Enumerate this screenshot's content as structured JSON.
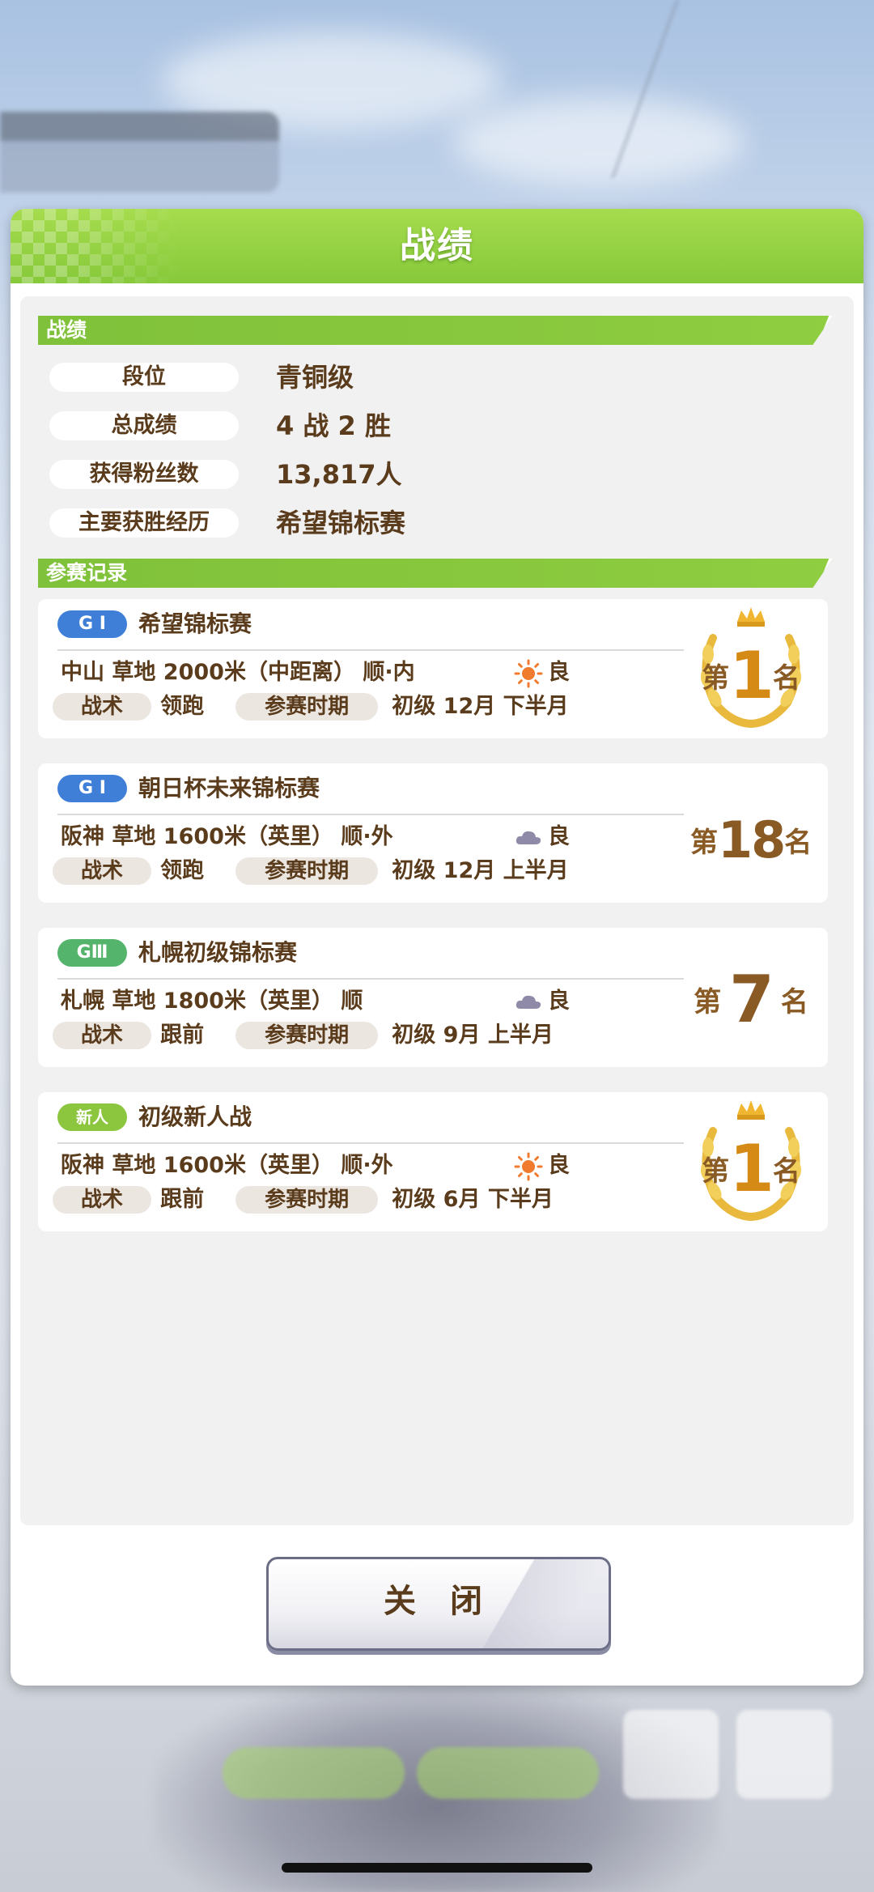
{
  "dialog": {
    "title": "战绩",
    "close_label": "关 闭"
  },
  "record_section": {
    "heading": "战绩",
    "stats": [
      {
        "label": "段位",
        "value": "青铜级"
      },
      {
        "label": "总成绩",
        "value": "4 战 2 胜"
      },
      {
        "label": "获得粉丝数",
        "value": "13,817人"
      },
      {
        "label": "主要获胜经历",
        "value": "希望锦标赛"
      }
    ]
  },
  "race_section": {
    "heading": "参赛记录",
    "tactic_label": "战术",
    "period_label": "参赛时期",
    "races": [
      {
        "grade": "G I",
        "name": "希望锦标赛",
        "venue": "中山  草地  2000米（中距离）  顺·内",
        "weather_icon": "sunny-icon",
        "condition": "良",
        "tactic": "领跑",
        "period": "初级  12月  下半月",
        "rank_pre": "第",
        "rank": "1",
        "rank_post": "名",
        "trophy": true
      },
      {
        "grade": "G I",
        "name": "朝日杯未来锦标赛",
        "venue": "阪神  草地  1600米（英里）  顺·外",
        "weather_icon": "cloudy-icon",
        "condition": "良",
        "tactic": "领跑",
        "period": "初级  12月  上半月",
        "rank_pre": "第",
        "rank": "18",
        "rank_post": "名",
        "trophy": false
      },
      {
        "grade": "GⅢ",
        "name": "札幌初级锦标赛",
        "venue": "札幌  草地  1800米（英里）  顺",
        "weather_icon": "cloudy-icon",
        "condition": "良",
        "tactic": "跟前",
        "period": "初级  9月  上半月",
        "rank_pre": "第",
        "rank": "7",
        "rank_post": "名",
        "trophy": false
      },
      {
        "grade": "新人",
        "name": "初级新人战",
        "venue": "阪神  草地  1600米（英里）  顺·外",
        "weather_icon": "sunny-icon",
        "condition": "良",
        "tactic": "跟前",
        "period": "初级  6月  下半月",
        "rank_pre": "第",
        "rank": "1",
        "rank_post": "名",
        "trophy": true
      }
    ]
  },
  "colors": {
    "header_green": "#8cc63f",
    "text_brown": "#5a3c1c",
    "rank_brown": "#8a5a25",
    "grade_g1": "#3f7fd8",
    "grade_g3": "#55b46c"
  }
}
